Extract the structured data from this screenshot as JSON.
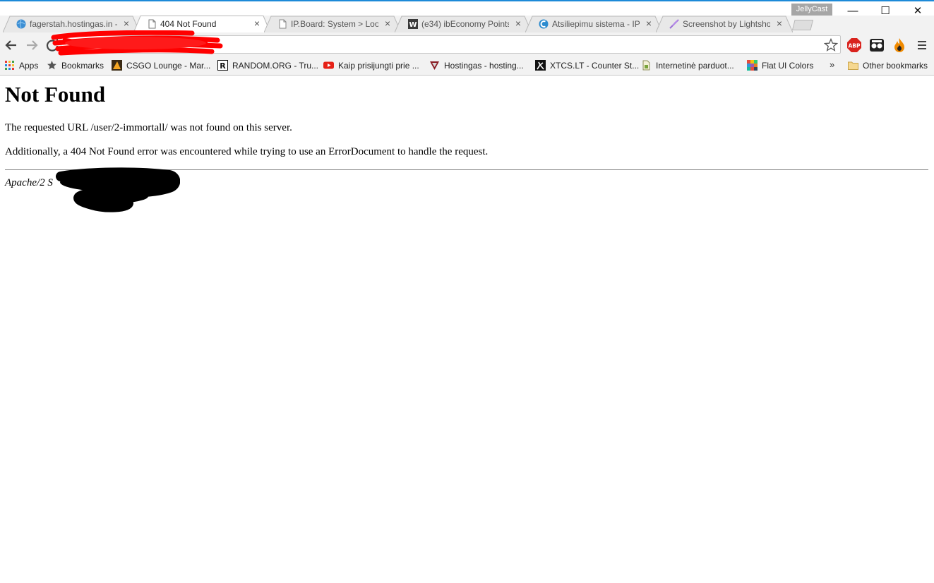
{
  "browser": {
    "profile_name": "JellyCast",
    "window_controls": {
      "minimize": "—",
      "maximize": "☐",
      "close": "✕"
    },
    "tabs": [
      {
        "title": "fagerstah.hostingas.in - I",
        "favicon": "globe-icon",
        "active": false
      },
      {
        "title": "404 Not Found",
        "favicon": "page-icon",
        "active": true
      },
      {
        "title": "IP.Board: System > Look",
        "favicon": "page-icon",
        "active": false
      },
      {
        "title": "(e34) ibEconomy Points",
        "favicon": "w-icon",
        "active": false
      },
      {
        "title": "Atsiliepimu sistema - IPB",
        "favicon": "ipb-icon",
        "active": false
      },
      {
        "title": "Screenshot by Lightshot",
        "favicon": "feather-icon",
        "active": false
      }
    ],
    "omnibox": {
      "url": "",
      "redacted": true
    },
    "bookmarks": [
      {
        "label": "Apps",
        "icon": "apps-grid-icon"
      },
      {
        "label": "Bookmarks",
        "icon": "star-icon"
      },
      {
        "label": "CSGO Lounge - Mar...",
        "icon": "csgo-lounge-icon"
      },
      {
        "label": "RANDOM.ORG - Tru...",
        "icon": "random-org-icon"
      },
      {
        "label": "Kaip prisijungti prie ...",
        "icon": "youtube-icon"
      },
      {
        "label": "Hostingas - hosting...",
        "icon": "hostingas-icon"
      },
      {
        "label": "XTCS.LT - Counter St...",
        "icon": "xtcs-icon"
      },
      {
        "label": "Internetinė parduot...",
        "icon": "shop-icon"
      },
      {
        "label": "Flat UI Colors",
        "icon": "flat-ui-icon"
      }
    ],
    "bookmarks_overflow": "»",
    "other_bookmarks": "Other bookmarks",
    "extensions": [
      "abp-icon",
      "ghostery-icon",
      "fire-icon"
    ]
  },
  "page": {
    "heading": "Not Found",
    "message": "The requested URL /user/2-immortall/ was not found on this server.",
    "additional": "Additionally, a 404 Not Found error was encountered while trying to use an ErrorDocument to handle the request.",
    "server_signature": "Apache/2 S"
  },
  "colors": {
    "accent": "#1d8ad8",
    "redaction_red": "#ff0000",
    "redaction_black": "#000000",
    "frame": "#f2f2f2"
  }
}
